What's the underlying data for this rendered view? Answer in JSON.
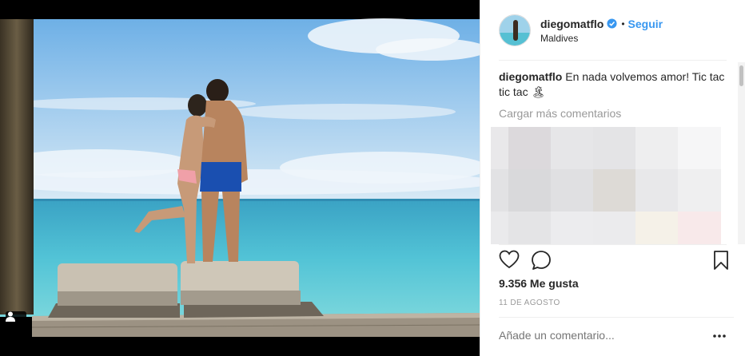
{
  "post": {
    "username": "diegomatflo",
    "follow_label": "Seguir",
    "separator": "•",
    "location": "Maldives",
    "caption_user": "diegomatflo",
    "caption_text": "En nada volvemos amor! Tic tac tic tac 🏝",
    "load_more": "Cargar más comentarios",
    "likes": "9.356 Me gusta",
    "date": "11 DE AGOSTO",
    "add_comment_placeholder": "Añade un comentario...",
    "more_options": "..."
  },
  "colors": {
    "accent": "#3897f0",
    "text": "#262626",
    "muted": "#999999",
    "sea": "#4fbad0",
    "sky": "#8fc3ea"
  },
  "icons": {
    "verified": "verified-badge-icon",
    "like": "heart-icon",
    "comment": "comment-icon",
    "save": "bookmark-icon",
    "tag": "user-tag-icon",
    "more": "more-options-icon"
  }
}
